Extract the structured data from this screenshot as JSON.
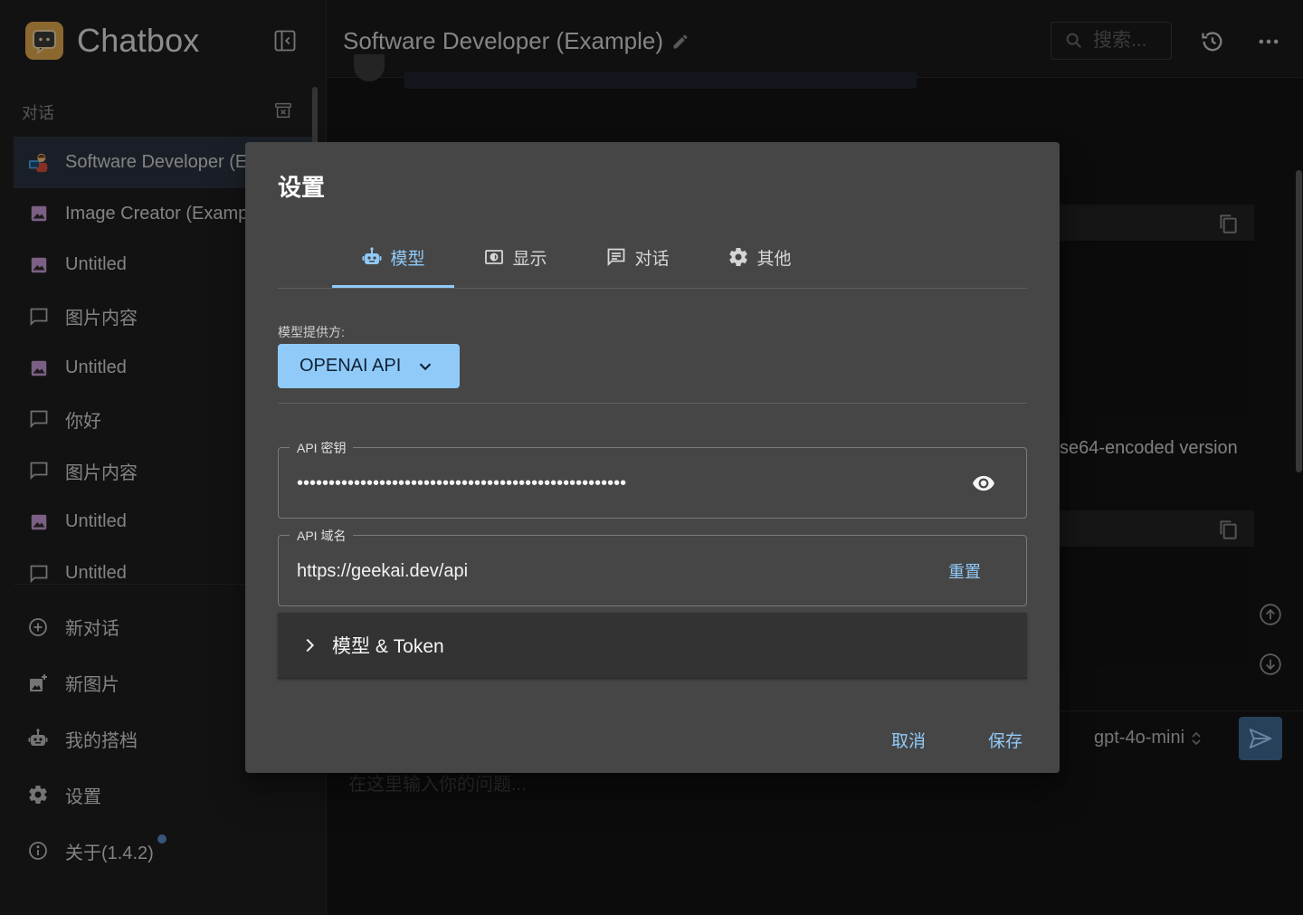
{
  "app": {
    "name": "Chatbox"
  },
  "sidebar": {
    "section_label": "对话",
    "conversations": [
      {
        "label": "Software Developer (Example)",
        "icon": "developer-avatar-icon",
        "active": true
      },
      {
        "label": "Image Creator (Example)",
        "icon": "image-icon"
      },
      {
        "label": "Untitled",
        "icon": "image-icon"
      },
      {
        "label": "图片内容",
        "icon": "chat-bubble-icon"
      },
      {
        "label": "Untitled",
        "icon": "image-icon"
      },
      {
        "label": "你好",
        "icon": "chat-bubble-icon"
      },
      {
        "label": "图片内容",
        "icon": "chat-bubble-icon"
      },
      {
        "label": "Untitled",
        "icon": "image-icon"
      },
      {
        "label": "Untitled",
        "icon": "chat-bubble-icon"
      }
    ],
    "actions": {
      "new_chat": "新对话",
      "new_image": "新图片",
      "my_copilots": "我的搭档",
      "settings": "设置",
      "about": "关于(1.4.2)"
    }
  },
  "header": {
    "session_title": "Software Developer (Example)",
    "search_placeholder": "搜索..."
  },
  "chat": {
    "background_text": "se64-encoded version",
    "model_name": "gpt-4o-mini",
    "input_placeholder": "在这里输入你的问题..."
  },
  "dialog": {
    "title": "设置",
    "tabs": [
      "模型",
      "显示",
      "对话",
      "其他"
    ],
    "active_tab": "模型",
    "provider_label": "模型提供方:",
    "provider_value": "OPENAI API",
    "api_key_label": "API 密钥",
    "api_key_value": "••••••••••••••••••••••••••••••••••••••••••••••••••••",
    "api_host_label": "API 域名",
    "api_host_value": "https://geekai.dev/api",
    "reset_label": "重置",
    "accordion_label": "模型 & Token",
    "cancel_label": "取消",
    "save_label": "保存"
  },
  "colors": {
    "accent": "#90caf9",
    "dialog_bg": "#464646",
    "sidebar_bg": "#1e1e1e",
    "active_item_bg": "#2b3340",
    "send_button_bg": "#3f6a94"
  }
}
